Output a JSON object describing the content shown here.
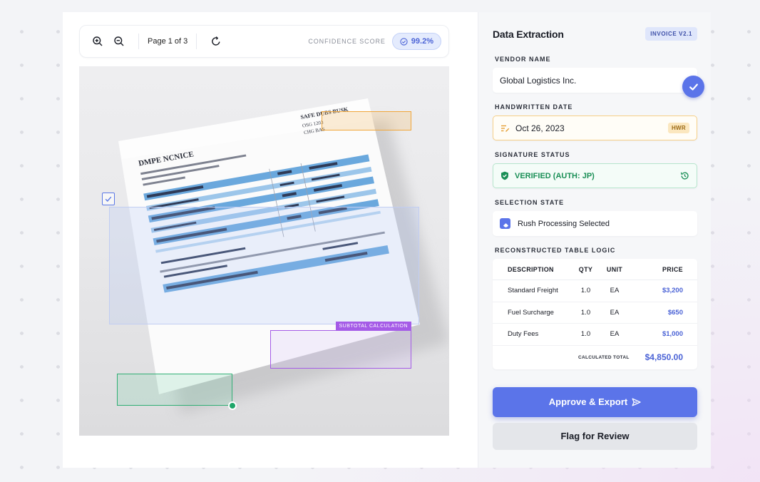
{
  "toolbar": {
    "zoom_in_icon": "zoom-in-icon",
    "zoom_out_icon": "zoom-out-icon",
    "page_indicator": "Page 1 of 3",
    "rotate_icon": "rotate-icon",
    "confidence_label": "CONFIDENCE SCORE",
    "confidence_value": "99.2%"
  },
  "document": {
    "annotations": {
      "subtotal_tag": "SUBTOTAL CALCULATION"
    },
    "printed_text": {
      "title": "DMPE NCNICE",
      "header_right": "SAFE DUBS BUSK",
      "header_right_2": "OSG 1203",
      "header_right_3": "CHG BAS"
    }
  },
  "panel": {
    "title": "Data Extraction",
    "version": "INVOICE V2.1",
    "vendor": {
      "label": "VENDOR NAME",
      "value": "Global Logistics Inc."
    },
    "date": {
      "label": "HANDWRITTEN DATE",
      "value": "Oct 26, 2023",
      "badge": "HWR"
    },
    "signature": {
      "label": "SIGNATURE STATUS",
      "value": "VERIFIED (AUTH: JP)"
    },
    "selection": {
      "label": "SELECTION STATE",
      "value": "Rush Processing Selected"
    },
    "table": {
      "label": "RECONSTRUCTED TABLE LOGIC",
      "headers": {
        "desc": "DESCRIPTION",
        "qty": "QTY",
        "unit": "UNIT",
        "price": "PRICE"
      },
      "rows": [
        {
          "desc": "Standard Freight",
          "qty": "1.0",
          "unit": "EA",
          "price": "$3,200"
        },
        {
          "desc": "Fuel Surcharge",
          "qty": "1.0",
          "unit": "EA",
          "price": "$650"
        },
        {
          "desc": "Duty Fees",
          "qty": "1.0",
          "unit": "EA",
          "price": "$1,000"
        }
      ],
      "total_label": "CALCULATED TOTAL",
      "total_value": "$4,850.00"
    },
    "approve_label": "Approve & Export",
    "flag_label": "Flag for Review"
  },
  "colors": {
    "accent": "#5b74e9",
    "success": "#1fa66a",
    "warning": "#f0a63a",
    "highlight": "#a55be7"
  }
}
